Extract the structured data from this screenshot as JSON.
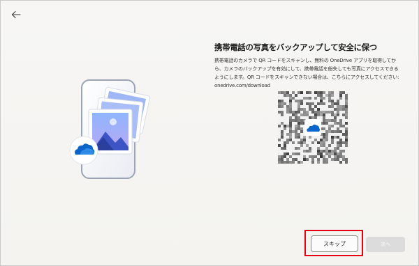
{
  "header": {
    "back_icon": "back-arrow-icon"
  },
  "main": {
    "title": "携帯電話の写真をバックアップして安全に保つ",
    "description_lines": [
      "携帯電話のカメラで QR コードをスキャンし、無料の OneDrive アプリを取得してか",
      "ら、カメラのバックアップを有効にして、携帯電話を紛失しても写真にアクセスできる",
      "ようにします。QR コードをスキャンできない場合は、こちらにアクセスしてください:",
      "onedrive.com/download"
    ],
    "illustration_icons": [
      "phone-icon",
      "photos-icon",
      "onedrive-cloud-icon"
    ],
    "qr_icon": "qr-code-icon"
  },
  "footer": {
    "skip_label": "スキップ",
    "next_label": "次へ"
  },
  "colors": {
    "highlight": "#e60012",
    "onedrive_blue": "#0a64c9"
  }
}
